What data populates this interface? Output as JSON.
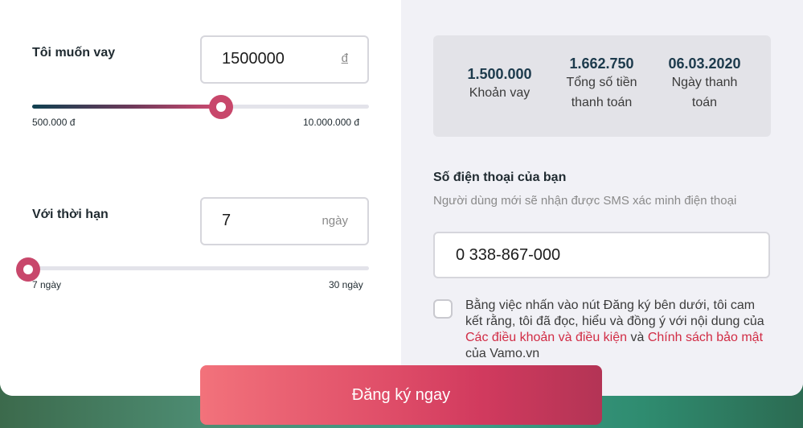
{
  "loan": {
    "amount_label": "Tôi muốn vay",
    "amount_value": "1500000",
    "amount_unit": "đ",
    "amount_min": "500.000 đ",
    "amount_max": "10.000.000 đ",
    "amount_fill_fraction": 0.54
  },
  "term": {
    "label": "Với thời hạn",
    "value": "7",
    "unit": "ngày",
    "min": "7 ngày",
    "max": "30 ngày",
    "fill_fraction": 0.0
  },
  "summary": {
    "loan_value": "1.500.000",
    "loan_caption": "Khoản vay",
    "total_value": "1.662.750",
    "total_caption_line1": "Tổng số tiền",
    "total_caption_line2": "thanh toán",
    "date_value": "06.03.2020",
    "date_caption_line1": "Ngày thanh",
    "date_caption_line2": "toán"
  },
  "phone": {
    "title": "Số điện thoại của bạn",
    "hint": "Người dùng mới sẽ nhận được SMS xác minh điện thoại",
    "value": "0 338-867-000"
  },
  "terms": {
    "text_before": "Bằng việc nhấn vào nút Đăng ký bên dưới, tôi cam kết rằng, tôi đã đọc, hiểu và đồng ý với nội dung của ",
    "link1": "Các điều khoản và điều kiện",
    "text_middle": " và ",
    "link2": "Chính sách bảo mật",
    "text_after": " của Vamo.vn"
  },
  "cta": {
    "label": "Đăng ký ngay"
  },
  "colors": {
    "accent": "#c8476b",
    "link": "#d12c45",
    "summary_value": "#1c3a4c"
  }
}
